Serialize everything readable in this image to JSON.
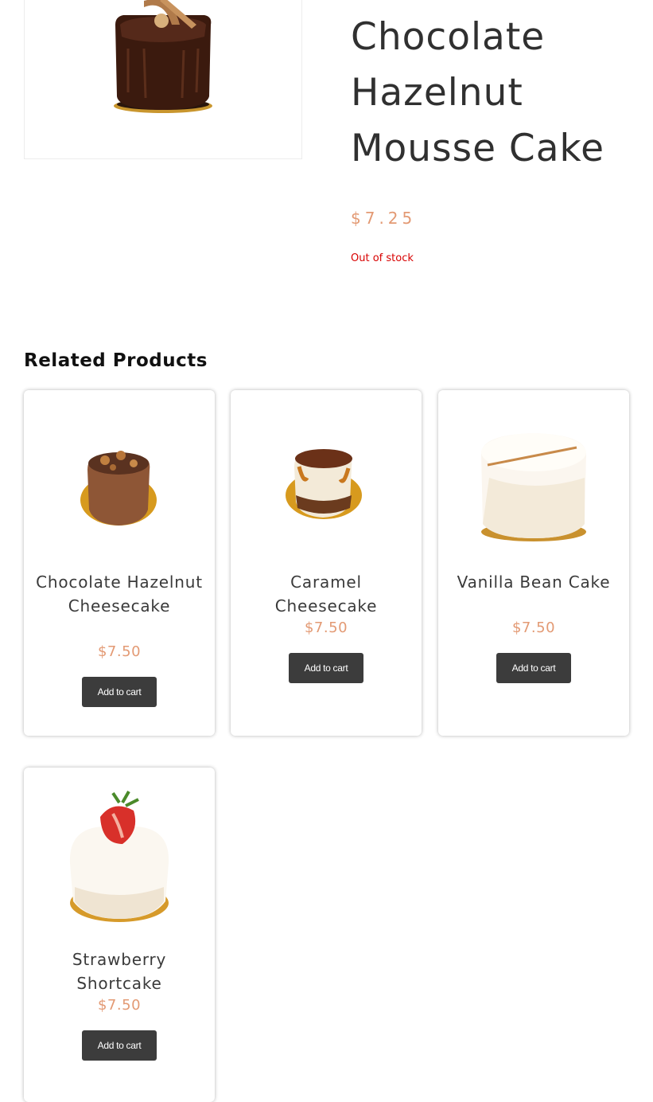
{
  "product": {
    "title": "Chocolate Hazelnut Mousse Cake",
    "price": "$7.25",
    "stock_status": "Out of stock"
  },
  "related": {
    "heading": "Related Products",
    "items": [
      {
        "name": "Chocolate Hazelnut Cheesecake",
        "price": "$7.50",
        "button": "Add to cart"
      },
      {
        "name": "Caramel Cheesecake",
        "price": "$7.50",
        "button": "Add to cart"
      },
      {
        "name": "Vanilla Bean Cake",
        "price": "$7.50",
        "button": "Add to cart"
      },
      {
        "name": "Strawberry Shortcake",
        "price": "$7.50",
        "button": "Add to cart"
      }
    ]
  },
  "colors": {
    "price": "#e39a74",
    "stock_out": "#d80000",
    "button_bg": "#3c3c3c",
    "title": "#303030"
  }
}
